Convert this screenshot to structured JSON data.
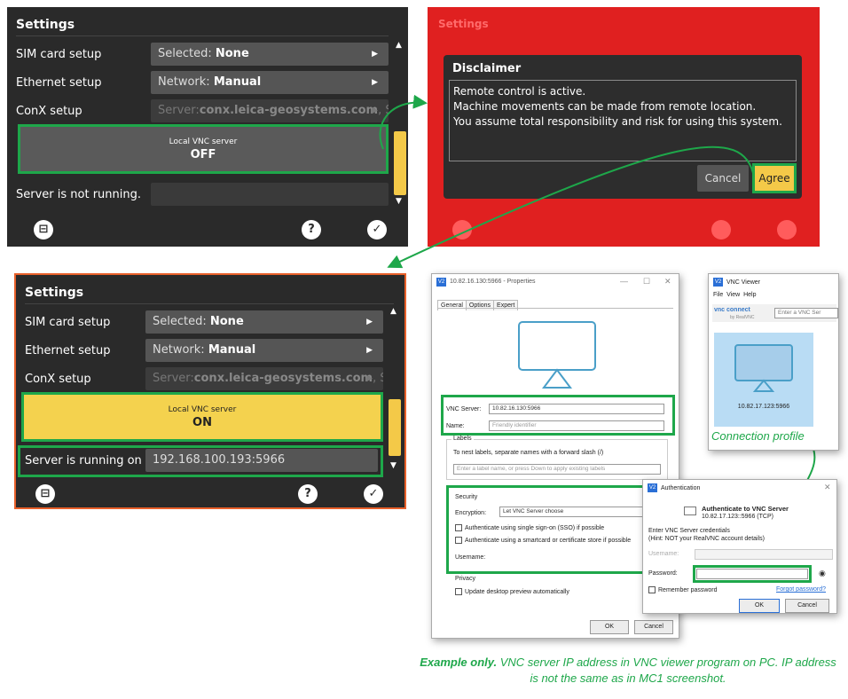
{
  "panel_off": {
    "title": "Settings",
    "rows": [
      {
        "label": "SIM card setup",
        "prefix": "Selected:",
        "value": "None"
      },
      {
        "label": "Ethernet setup",
        "prefix": "Network:",
        "value": "Manual"
      },
      {
        "label": "ConX setup",
        "prefix": "Server:",
        "value": "conx.leica-geosystems.com",
        "suffix": ", S..."
      }
    ],
    "toggle_label": "Local VNC server",
    "toggle_state": "OFF",
    "status_label": "Server is not running.",
    "status_value": ""
  },
  "panel_on": {
    "title": "Settings",
    "rows": [
      {
        "label": "SIM card setup",
        "prefix": "Selected:",
        "value": "None"
      },
      {
        "label": "Ethernet setup",
        "prefix": "Network:",
        "value": "Manual"
      },
      {
        "label": "ConX setup",
        "prefix": "Server:",
        "value": "conx.leica-geosystems.com",
        "suffix": ", S..."
      }
    ],
    "toggle_label": "Local VNC server",
    "toggle_state": "ON",
    "status_label": "Server is running on IP",
    "status_value": "192.168.100.193:5966"
  },
  "disclaimer": {
    "ghost_title": "Settings",
    "title": "Disclaimer",
    "lines": [
      "Remote control is active.",
      "Machine movements can be made from remote location.",
      "You assume total responsibility and risk for using this system."
    ],
    "cancel": "Cancel",
    "agree": "Agree"
  },
  "properties": {
    "title": "10.82.16.130:5966 - Properties",
    "tabs": [
      "General",
      "Options",
      "Expert"
    ],
    "server_label": "VNC Server:",
    "server_value": "10.82.16.130:5966",
    "name_label": "Name:",
    "name_placeholder": "Friendly identifier",
    "labels_heading": "Labels",
    "labels_hint": "To nest labels, separate names with a forward slash (/)",
    "labels_placeholder": "Enter a label name, or press Down to apply existing labels",
    "security_heading": "Security",
    "encryption_label": "Encryption:",
    "encryption_value": "Let VNC Server choose",
    "sso": "Authenticate using single sign-on (SSO) if possible",
    "smartcard": "Authenticate using a smartcard or certificate store if possible",
    "username_label": "Username:",
    "privacy_heading": "Privacy",
    "preview": "Update desktop preview automatically",
    "ok": "OK",
    "cancel": "Cancel"
  },
  "viewer": {
    "title": "VNC Viewer",
    "menu": [
      "File",
      "View",
      "Help"
    ],
    "brand": "vnc connect",
    "brand_sub": "by RealVNC",
    "search_placeholder": "Enter a VNC Ser",
    "profile_address": "10.82.17.123:5966",
    "connection_label": "Connection profile"
  },
  "auth": {
    "title": "Authentication",
    "heading": "Authenticate to VNC Server",
    "address": "10.82.17.123::5966 (TCP)",
    "instructions": "Enter VNC Server credentials",
    "hint": "(Hint: NOT your RealVNC account details)",
    "username_label": "Username:",
    "password_label": "Password:",
    "remember": "Remember password",
    "forgot": "Forgot password?",
    "ok": "OK",
    "cancel": "Cancel"
  },
  "caption": {
    "bold": "Example only.",
    "rest": " VNC server IP address in VNC viewer program on PC. IP address is not the same as in MC1 screenshot."
  },
  "colors": {
    "accent_green": "#1ea74a",
    "yellow": "#f4c948",
    "red": "#e02020",
    "panel_bg": "#2a2a2a"
  }
}
